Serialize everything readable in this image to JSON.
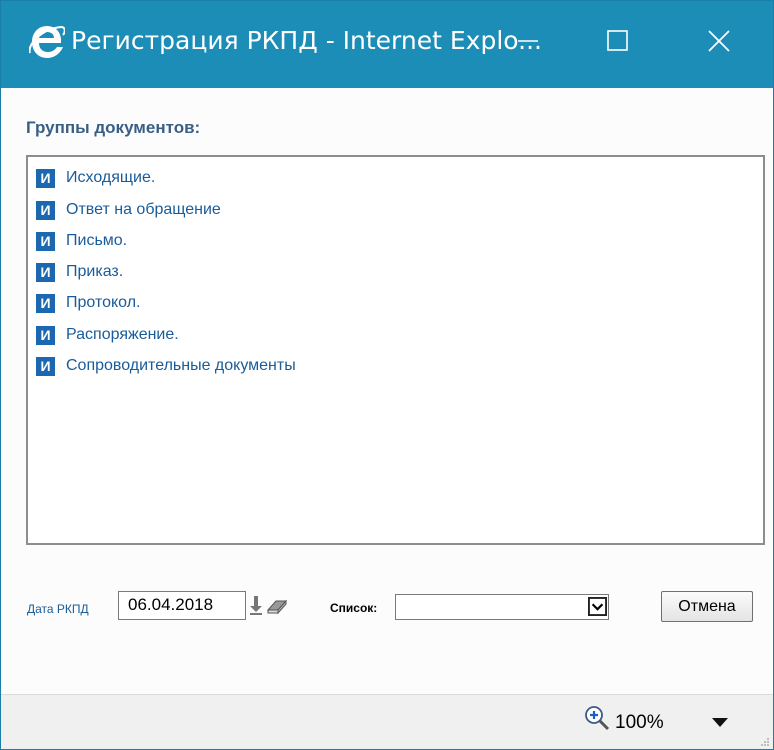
{
  "window": {
    "title": "Регистрация РКПД - Internet Explo..."
  },
  "main": {
    "groups_label": "Группы документов:",
    "icon_letter": "И",
    "groups": [
      "Исходящие.",
      "Ответ на обращение",
      "Письмо.",
      "Приказ.",
      "Протокол.",
      "Распоряжение.",
      "Сопроводительные документы"
    ]
  },
  "footer": {
    "date_label": "Дата РКПД",
    "date_value": "06.04.2018",
    "list_label": "Список:",
    "list_selected": "",
    "cancel_label": "Отмена"
  },
  "statusbar": {
    "zoom": "100%"
  },
  "colors": {
    "titlebar": "#1c8db7",
    "link_blue": "#1a5c99",
    "icon_blue": "#1b67b0",
    "heading": "#3a5f85"
  },
  "icons": {
    "app": "internet-explorer-icon",
    "minimize": "minimize-icon",
    "maximize": "maximize-icon",
    "close": "close-icon",
    "date_download": "down-arrow-icon",
    "clear": "eraser-icon",
    "zoom": "zoom-in-icon"
  }
}
